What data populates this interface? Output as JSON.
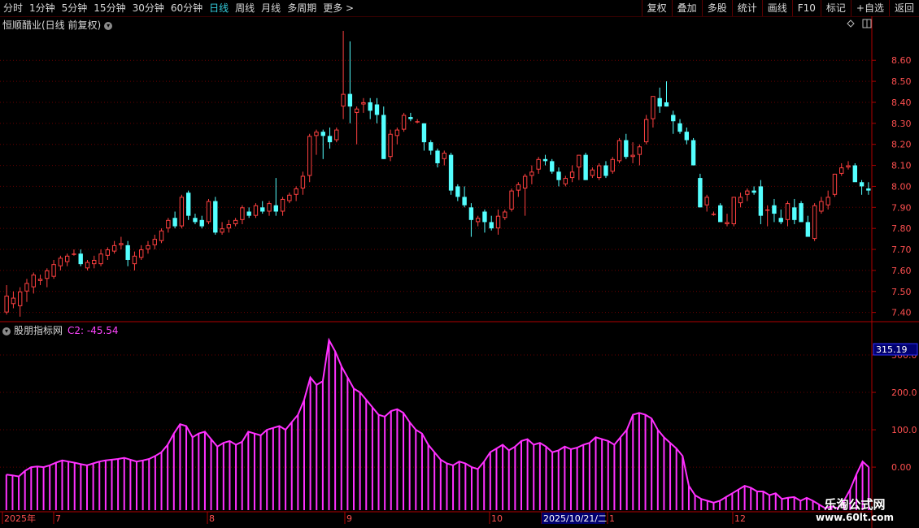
{
  "toolbar": {
    "periods": [
      "分时",
      "1分钟",
      "5分钟",
      "15分钟",
      "30分钟",
      "60分钟",
      "日线",
      "周线",
      "月线",
      "多周期",
      "更多 >"
    ],
    "active_period": "日线",
    "actions": [
      "复权",
      "叠加",
      "多股",
      "统计",
      "画线",
      "F10",
      "标记",
      "+自选",
      "返回"
    ]
  },
  "main_panel": {
    "title": "恒顺醋业(日线 前复权)"
  },
  "indicator_panel": {
    "title": "股朋指标网",
    "value_label": "C2: -45.54",
    "current_value_box": "315.19"
  },
  "price_axis": {
    "ticks": [
      "8.60",
      "8.50",
      "8.40",
      "8.30",
      "8.20",
      "8.10",
      "8.00",
      "7.90",
      "7.80",
      "7.70",
      "7.60",
      "7.50",
      "7.40"
    ]
  },
  "indicator_axis": {
    "ticks": [
      "300.0",
      "200.0",
      "100.0",
      "0.00"
    ]
  },
  "time_axis": {
    "labels": [
      "2025年",
      "7",
      "8",
      "9",
      "10",
      "2025/10/21/二",
      "1",
      "12"
    ]
  },
  "watermark": {
    "line1": "乐淘公式网",
    "line2": "www.60lt.com"
  },
  "colors": {
    "up": "#ff4040",
    "down": "#54ffff",
    "indicator": "#ff30ff",
    "grid": "#6a0000",
    "axis": "#b00000"
  },
  "chart_data": [
    {
      "type": "candlestick",
      "title": "恒顺醋业(日线 前复权)",
      "ylim": [
        7.36,
        8.74
      ],
      "note_order": "bars in time order, each [open, high, low, close]",
      "bars": [
        [
          7.4,
          7.53,
          7.39,
          7.48
        ],
        [
          7.44,
          7.5,
          7.42,
          7.47
        ],
        [
          7.43,
          7.52,
          7.38,
          7.5
        ],
        [
          7.5,
          7.56,
          7.45,
          7.54
        ],
        [
          7.52,
          7.59,
          7.49,
          7.58
        ],
        [
          7.55,
          7.58,
          7.53,
          7.56
        ],
        [
          7.56,
          7.61,
          7.52,
          7.6
        ],
        [
          7.57,
          7.65,
          7.56,
          7.63
        ],
        [
          7.62,
          7.67,
          7.6,
          7.66
        ],
        [
          7.64,
          7.68,
          7.62,
          7.67
        ],
        [
          7.68,
          7.7,
          7.67,
          7.68
        ],
        [
          7.68,
          7.7,
          7.62,
          7.63
        ],
        [
          7.61,
          7.65,
          7.6,
          7.64
        ],
        [
          7.63,
          7.67,
          7.61,
          7.65
        ],
        [
          7.63,
          7.7,
          7.62,
          7.68
        ],
        [
          7.67,
          7.71,
          7.65,
          7.7
        ],
        [
          7.69,
          7.74,
          7.68,
          7.72
        ],
        [
          7.72,
          7.76,
          7.7,
          7.73
        ],
        [
          7.72,
          7.74,
          7.62,
          7.65
        ],
        [
          7.63,
          7.69,
          7.6,
          7.67
        ],
        [
          7.66,
          7.72,
          7.65,
          7.7
        ],
        [
          7.7,
          7.74,
          7.68,
          7.72
        ],
        [
          7.72,
          7.77,
          7.7,
          7.75
        ],
        [
          7.74,
          7.8,
          7.73,
          7.79
        ],
        [
          7.8,
          7.85,
          7.78,
          7.84
        ],
        [
          7.85,
          7.88,
          7.8,
          7.81
        ],
        [
          7.81,
          7.96,
          7.8,
          7.95
        ],
        [
          7.97,
          7.98,
          7.84,
          7.86
        ],
        [
          7.85,
          7.87,
          7.82,
          7.83
        ],
        [
          7.84,
          7.86,
          7.8,
          7.81
        ],
        [
          7.83,
          7.94,
          7.82,
          7.93
        ],
        [
          7.93,
          7.95,
          7.77,
          7.78
        ],
        [
          7.78,
          7.83,
          7.77,
          7.8
        ],
        [
          7.8,
          7.84,
          7.78,
          7.82
        ],
        [
          7.82,
          7.85,
          7.81,
          7.84
        ],
        [
          7.84,
          7.91,
          7.82,
          7.9
        ],
        [
          7.88,
          7.9,
          7.85,
          7.86
        ],
        [
          7.86,
          7.92,
          7.85,
          7.91
        ],
        [
          7.9,
          7.93,
          7.87,
          7.88
        ],
        [
          7.88,
          7.93,
          7.86,
          7.92
        ],
        [
          7.91,
          8.04,
          7.86,
          7.88
        ],
        [
          7.88,
          7.95,
          7.86,
          7.94
        ],
        [
          7.93,
          7.97,
          7.92,
          7.96
        ],
        [
          7.96,
          8.0,
          7.93,
          7.99
        ],
        [
          7.99,
          8.07,
          7.96,
          8.05
        ],
        [
          8.05,
          8.25,
          8.02,
          8.24
        ],
        [
          8.24,
          8.27,
          8.15,
          8.26
        ],
        [
          8.26,
          8.27,
          8.13,
          8.24
        ],
        [
          8.24,
          8.28,
          8.18,
          8.21
        ],
        [
          8.22,
          8.28,
          8.21,
          8.27
        ],
        [
          8.38,
          8.74,
          8.32,
          8.44
        ],
        [
          8.44,
          8.69,
          8.3,
          8.38
        ],
        [
          8.35,
          8.38,
          8.2,
          8.37
        ],
        [
          8.39,
          8.42,
          8.35,
          8.4
        ],
        [
          8.4,
          8.42,
          8.32,
          8.36
        ],
        [
          8.39,
          8.42,
          8.3,
          8.34
        ],
        [
          8.34,
          8.38,
          8.13,
          8.13
        ],
        [
          8.14,
          8.27,
          8.12,
          8.25
        ],
        [
          8.24,
          8.28,
          8.2,
          8.27
        ],
        [
          8.27,
          8.35,
          8.26,
          8.34
        ],
        [
          8.33,
          8.35,
          8.31,
          8.32
        ],
        [
          8.31,
          8.32,
          8.3,
          8.31
        ],
        [
          8.3,
          8.3,
          8.17,
          8.21
        ],
        [
          8.21,
          8.22,
          8.15,
          8.17
        ],
        [
          8.17,
          8.18,
          8.09,
          8.11
        ],
        [
          8.13,
          8.17,
          8.1,
          8.16
        ],
        [
          8.15,
          8.16,
          7.96,
          7.98
        ],
        [
          8.0,
          8.01,
          7.93,
          7.95
        ],
        [
          7.95,
          8.0,
          7.9,
          7.91
        ],
        [
          7.9,
          7.92,
          7.76,
          7.84
        ],
        [
          7.83,
          7.86,
          7.81,
          7.85
        ],
        [
          7.88,
          7.89,
          7.78,
          7.83
        ],
        [
          7.83,
          7.86,
          7.79,
          7.8
        ],
        [
          7.8,
          7.89,
          7.77,
          7.86
        ],
        [
          7.85,
          7.89,
          7.84,
          7.88
        ],
        [
          7.89,
          7.99,
          7.88,
          7.98
        ],
        [
          7.98,
          8.02,
          7.95,
          8.01
        ],
        [
          7.99,
          8.06,
          7.86,
          8.05
        ],
        [
          8.05,
          8.1,
          8.01,
          8.07
        ],
        [
          8.08,
          8.14,
          8.06,
          8.13
        ],
        [
          8.13,
          8.15,
          8.1,
          8.12
        ],
        [
          8.12,
          8.13,
          8.06,
          8.07
        ],
        [
          8.07,
          8.09,
          8.0,
          8.03
        ],
        [
          8.01,
          8.05,
          8.0,
          8.04
        ],
        [
          8.04,
          8.1,
          8.02,
          8.07
        ],
        [
          8.09,
          8.15,
          8.03,
          8.15
        ],
        [
          8.15,
          8.16,
          8.03,
          8.03
        ],
        [
          8.05,
          8.09,
          8.04,
          8.08
        ],
        [
          8.04,
          8.11,
          8.03,
          8.1
        ],
        [
          8.1,
          8.12,
          8.04,
          8.05
        ],
        [
          8.07,
          8.14,
          8.06,
          8.13
        ],
        [
          8.12,
          8.23,
          8.11,
          8.22
        ],
        [
          8.22,
          8.25,
          8.13,
          8.14
        ],
        [
          8.14,
          8.21,
          8.11,
          8.15
        ],
        [
          8.15,
          8.2,
          8.1,
          8.19
        ],
        [
          8.21,
          8.34,
          8.2,
          8.32
        ],
        [
          8.32,
          8.41,
          8.28,
          8.43
        ],
        [
          8.42,
          8.47,
          8.35,
          8.38
        ],
        [
          8.4,
          8.5,
          8.38,
          8.38
        ],
        [
          8.34,
          8.36,
          8.25,
          8.31
        ],
        [
          8.3,
          8.32,
          8.25,
          8.26
        ],
        [
          8.26,
          8.28,
          8.2,
          8.22
        ],
        [
          8.22,
          8.23,
          8.1,
          8.1
        ],
        [
          8.04,
          8.06,
          7.9,
          7.9
        ],
        [
          7.91,
          7.96,
          7.88,
          7.95
        ],
        [
          7.87,
          7.88,
          7.86,
          7.87
        ],
        [
          7.91,
          7.92,
          7.84,
          7.83
        ],
        [
          7.82,
          7.87,
          7.81,
          7.83
        ],
        [
          7.82,
          7.95,
          7.81,
          7.95
        ],
        [
          7.92,
          7.97,
          7.9,
          7.95
        ],
        [
          7.96,
          7.99,
          7.93,
          7.98
        ],
        [
          7.98,
          8.0,
          7.96,
          7.97
        ],
        [
          8.0,
          8.03,
          7.82,
          7.86
        ],
        [
          7.89,
          7.91,
          7.81,
          7.89
        ],
        [
          7.91,
          7.94,
          7.83,
          7.87
        ],
        [
          7.85,
          7.89,
          7.82,
          7.83
        ],
        [
          7.84,
          7.93,
          7.81,
          7.92
        ],
        [
          7.9,
          7.94,
          7.82,
          7.84
        ],
        [
          7.92,
          7.93,
          7.9,
          7.83
        ],
        [
          7.83,
          7.86,
          7.76,
          7.76
        ],
        [
          7.75,
          7.92,
          7.74,
          7.91
        ],
        [
          7.88,
          7.95,
          7.87,
          7.93
        ],
        [
          7.91,
          7.98,
          7.89,
          7.95
        ],
        [
          7.96,
          8.06,
          7.95,
          8.06
        ],
        [
          8.06,
          8.11,
          8.05,
          8.09
        ],
        [
          8.09,
          8.12,
          8.08,
          8.1
        ],
        [
          8.1,
          8.11,
          8.04,
          8.02
        ],
        [
          8.02,
          8.03,
          7.96,
          8.0
        ],
        [
          7.99,
          8.02,
          7.96,
          7.98
        ]
      ]
    },
    {
      "type": "bar",
      "title": "股朋指标网",
      "ylim": [
        -115,
        350
      ],
      "values": [
        -20,
        -22,
        -25,
        -10,
        0,
        2,
        0,
        5,
        12,
        18,
        15,
        12,
        8,
        5,
        10,
        15,
        18,
        20,
        22,
        25,
        20,
        15,
        18,
        22,
        30,
        40,
        60,
        90,
        115,
        110,
        80,
        90,
        95,
        75,
        55,
        65,
        70,
        60,
        68,
        95,
        90,
        85,
        100,
        105,
        110,
        100,
        120,
        140,
        180,
        240,
        220,
        230,
        340,
        310,
        270,
        240,
        210,
        200,
        180,
        160,
        140,
        135,
        150,
        155,
        145,
        120,
        100,
        90,
        60,
        40,
        20,
        10,
        5,
        15,
        10,
        0,
        -5,
        15,
        40,
        50,
        60,
        45,
        55,
        70,
        75,
        60,
        65,
        55,
        40,
        45,
        55,
        48,
        52,
        60,
        65,
        80,
        75,
        70,
        60,
        80,
        100,
        140,
        145,
        140,
        130,
        100,
        80,
        65,
        50,
        30,
        -50,
        -75,
        -85,
        -90,
        -95,
        -90,
        -80,
        -70,
        -60,
        -50,
        -55,
        -65,
        -65,
        -75,
        -70,
        -85,
        -82,
        -80,
        -90,
        -82,
        -90,
        -100,
        -110,
        -105,
        -110,
        -90,
        -60,
        -20,
        15,
        0
      ]
    }
  ]
}
